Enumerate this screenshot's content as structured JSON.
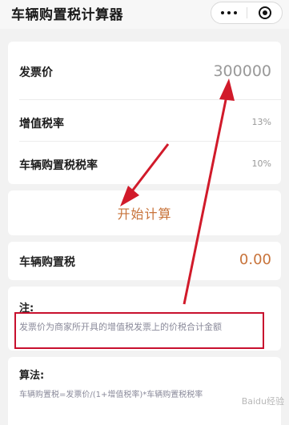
{
  "header": {
    "title": "车辆购置税计算器"
  },
  "inputs": {
    "invoice_price": {
      "label": "发票价",
      "value": "300000"
    },
    "vat_rate": {
      "label": "增值税率",
      "value": "13%"
    },
    "purchase_tax_rate": {
      "label": "车辆购置税税率",
      "value": "10%"
    }
  },
  "calculate_button": {
    "label": "开始计算"
  },
  "result": {
    "label": "车辆购置税",
    "value": "0.00"
  },
  "note": {
    "title": "注:",
    "text": "发票价为商家所开具的增值税发票上的价税合计金额"
  },
  "formula": {
    "title": "算法:",
    "text": "车辆购置税=发票价/(1+增值税率)*车辆购置税税率"
  },
  "watermark": {
    "text": "Baidu经验"
  },
  "colors": {
    "accent": "#c8733a",
    "annotation": "#c8102e",
    "background": "#f2f2f2"
  }
}
